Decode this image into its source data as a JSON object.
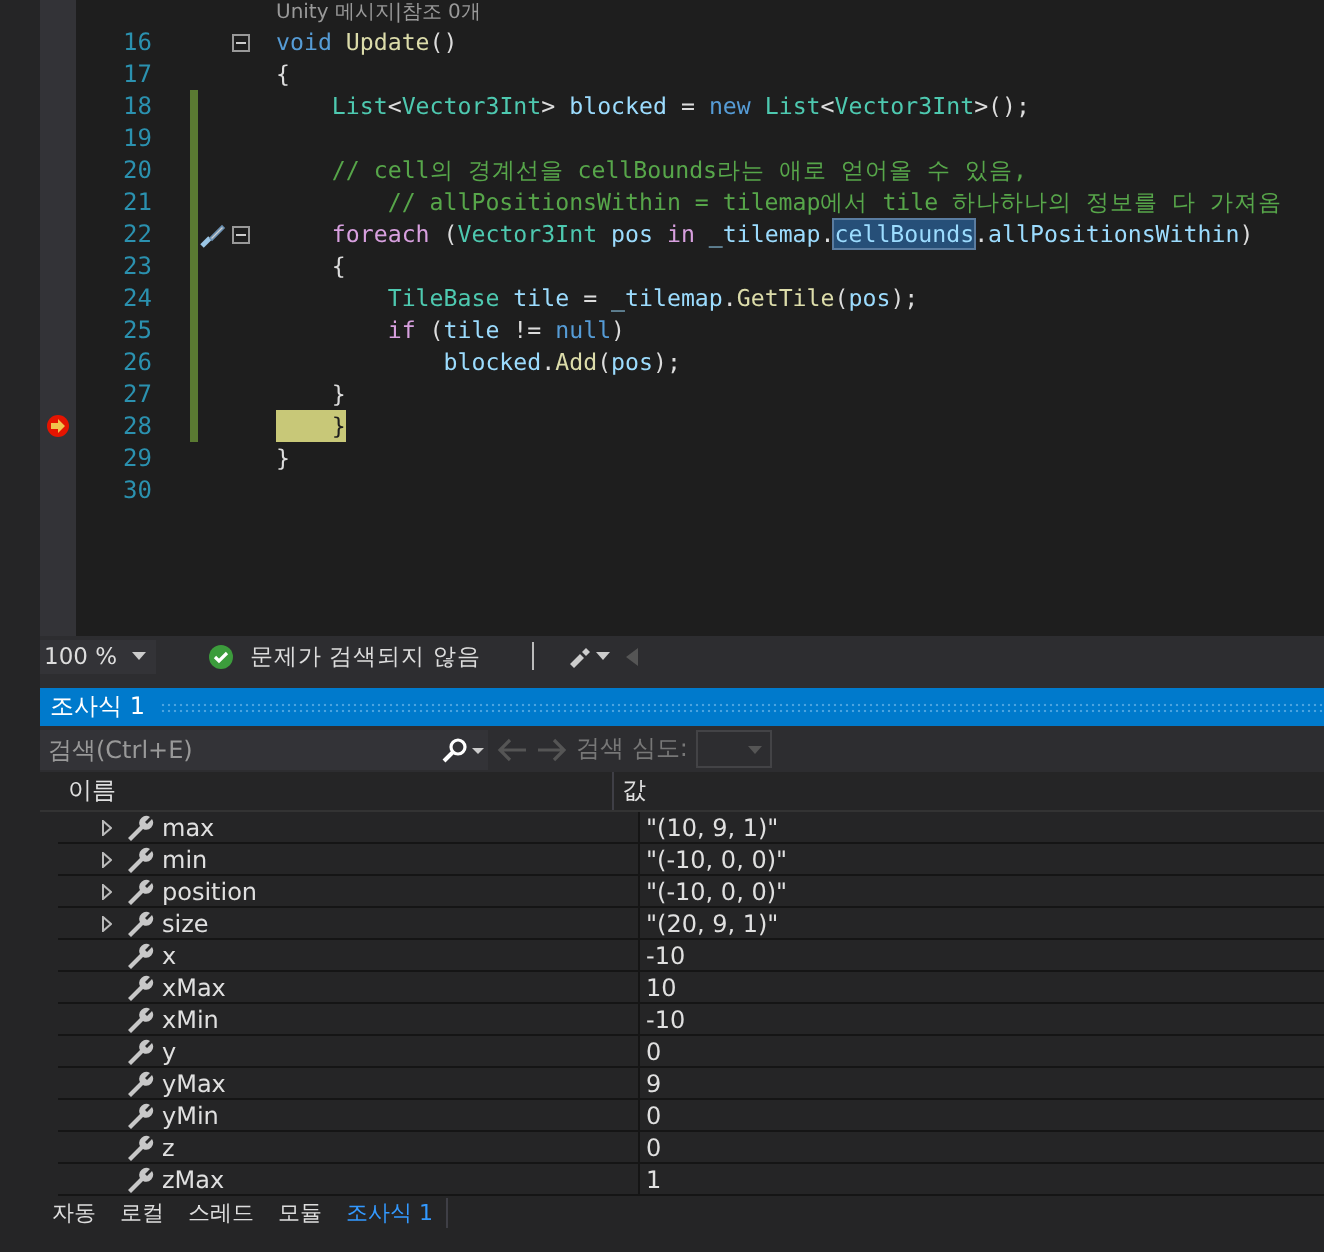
{
  "editor": {
    "codelens": "Unity 메시지|참조 0개",
    "lines": [
      {
        "number": "16",
        "fold": true,
        "changed": false,
        "current": false,
        "tokens": [
          {
            "kind": "kw",
            "text": "void"
          },
          {
            "kind": "method",
            "text": " Update"
          },
          {
            "kind": "plain",
            "text": "()"
          }
        ]
      },
      {
        "number": "17",
        "fold": false,
        "changed": false,
        "current": false,
        "tokens": [
          {
            "kind": "plain",
            "text": "{"
          }
        ]
      },
      {
        "number": "18",
        "fold": false,
        "changed": true,
        "current": false,
        "tokens": [
          {
            "kind": "type",
            "text": "    List"
          },
          {
            "kind": "plain",
            "text": "<"
          },
          {
            "kind": "type",
            "text": "Vector3Int"
          },
          {
            "kind": "plain",
            "text": "> "
          },
          {
            "kind": "var",
            "text": "blocked"
          },
          {
            "kind": "plain",
            "text": " = "
          },
          {
            "kind": "kw",
            "text": "new "
          },
          {
            "kind": "type",
            "text": "List"
          },
          {
            "kind": "plain",
            "text": "<"
          },
          {
            "kind": "type",
            "text": "Vector3Int"
          },
          {
            "kind": "plain",
            "text": ">();"
          }
        ]
      },
      {
        "number": "19",
        "fold": false,
        "changed": true,
        "current": false
      },
      {
        "number": "20",
        "fold": false,
        "changed": true,
        "current": false,
        "tokens": [
          {
            "kind": "comment",
            "text": "    // cell의 경계선을 cellBounds라는 애로 얻어올 수 있음,"
          }
        ]
      },
      {
        "number": "21",
        "fold": false,
        "changed": true,
        "current": false,
        "tokens": [
          {
            "kind": "comment",
            "text": "        // allPositionsWithin = tilemap에서 tile 하나하나의 정보를 다 가져옴"
          }
        ]
      },
      {
        "number": "22",
        "fold": true,
        "changed": true,
        "current": false,
        "tokens": [
          {
            "kind": "control",
            "text": "    foreach"
          },
          {
            "kind": "plain",
            "text": " ("
          },
          {
            "kind": "type",
            "text": "Vector3Int"
          },
          {
            "kind": "var",
            "text": " pos"
          },
          {
            "kind": "control",
            "text": " in"
          },
          {
            "kind": "var",
            "text": " _tilemap"
          },
          {
            "kind": "plain",
            "text": "."
          },
          {
            "kind": "selected",
            "text": "cellBounds"
          },
          {
            "kind": "plain",
            "text": "."
          },
          {
            "kind": "var",
            "text": "allPositionsWithin"
          },
          {
            "kind": "plain",
            "text": ")"
          }
        ]
      },
      {
        "number": "23",
        "fold": false,
        "changed": true,
        "current": false,
        "tokens": [
          {
            "kind": "plain",
            "text": "    {"
          }
        ]
      },
      {
        "number": "24",
        "fold": false,
        "changed": true,
        "current": false,
        "tokens": [
          {
            "kind": "type",
            "text": "        TileBase"
          },
          {
            "kind": "var",
            "text": " tile"
          },
          {
            "kind": "plain",
            "text": " = "
          },
          {
            "kind": "var",
            "text": "_tilemap"
          },
          {
            "kind": "plain",
            "text": "."
          },
          {
            "kind": "method",
            "text": "GetTile"
          },
          {
            "kind": "plain",
            "text": "("
          },
          {
            "kind": "var",
            "text": "pos"
          },
          {
            "kind": "plain",
            "text": ");"
          }
        ]
      },
      {
        "number": "25",
        "fold": false,
        "changed": true,
        "current": false,
        "tokens": [
          {
            "kind": "control",
            "text": "        if"
          },
          {
            "kind": "plain",
            "text": " ("
          },
          {
            "kind": "var",
            "text": "tile"
          },
          {
            "kind": "plain",
            "text": " != "
          },
          {
            "kind": "kw",
            "text": "null"
          },
          {
            "kind": "plain",
            "text": ")"
          }
        ]
      },
      {
        "number": "26",
        "fold": false,
        "changed": true,
        "current": false,
        "tokens": [
          {
            "kind": "var",
            "text": "            blocked"
          },
          {
            "kind": "plain",
            "text": "."
          },
          {
            "kind": "method",
            "text": "Add"
          },
          {
            "kind": "plain",
            "text": "("
          },
          {
            "kind": "var",
            "text": "pos"
          },
          {
            "kind": "plain",
            "text": ");"
          }
        ]
      },
      {
        "number": "27",
        "fold": false,
        "changed": true,
        "current": false,
        "tokens": [
          {
            "kind": "plain",
            "text": "    }"
          }
        ]
      },
      {
        "number": "28",
        "fold": false,
        "changed": true,
        "current": true,
        "tokens": [
          {
            "kind": "plain",
            "text": "    }"
          }
        ]
      },
      {
        "number": "29",
        "fold": false,
        "changed": false,
        "current": false,
        "tokens": [
          {
            "kind": "plain",
            "text": "}"
          }
        ]
      },
      {
        "number": "30",
        "fold": false,
        "changed": false,
        "current": false
      }
    ]
  },
  "status": {
    "zoom": "100 %",
    "issues": "문제가 검색되지 않음"
  },
  "watch": {
    "title": "조사식 1",
    "search": {
      "placeholder": "검색(Ctrl+E)"
    },
    "depth_label": "검색 심도:",
    "columns": [
      "이름",
      "값"
    ],
    "rows": [
      {
        "name": "max",
        "value": "\"(10, 9, 1)\"",
        "expandable": true
      },
      {
        "name": "min",
        "value": "\"(-10, 0, 0)\"",
        "expandable": true
      },
      {
        "name": "position",
        "value": "\"(-10, 0, 0)\"",
        "expandable": true
      },
      {
        "name": "size",
        "value": "\"(20, 9, 1)\"",
        "expandable": true
      },
      {
        "name": "x",
        "value": "-10",
        "expandable": false
      },
      {
        "name": "xMax",
        "value": "10",
        "expandable": false
      },
      {
        "name": "xMin",
        "value": "-10",
        "expandable": false
      },
      {
        "name": "y",
        "value": "0",
        "expandable": false
      },
      {
        "name": "yMax",
        "value": "9",
        "expandable": false
      },
      {
        "name": "yMin",
        "value": "0",
        "expandable": false
      },
      {
        "name": "z",
        "value": "0",
        "expandable": false
      },
      {
        "name": "zMax",
        "value": "1",
        "expandable": false
      }
    ]
  },
  "bottom_tabs": [
    {
      "label": "자동",
      "selected": false
    },
    {
      "label": "로컬",
      "selected": false
    },
    {
      "label": "스레드",
      "selected": false
    },
    {
      "label": "모듈",
      "selected": false
    },
    {
      "label": "조사식 1",
      "selected": true
    }
  ]
}
